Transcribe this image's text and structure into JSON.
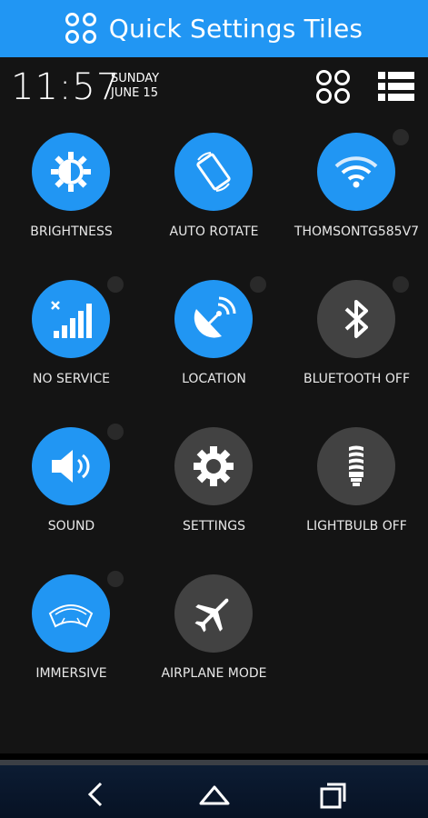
{
  "app": {
    "title": "Quick Settings Tiles",
    "accent": "#2196f3"
  },
  "status": {
    "time": "11:57",
    "day": "SUNDAY",
    "date": "JUNE 15"
  },
  "tiles": [
    {
      "label": "BRIGHTNESS",
      "state": "on",
      "icon": "brightness-icon"
    },
    {
      "label": "AUTO ROTATE",
      "state": "on",
      "icon": "auto-rotate-icon"
    },
    {
      "label": "THOMSONTG585V7",
      "state": "on",
      "icon": "wifi-icon"
    },
    {
      "label": "NO SERVICE",
      "state": "on",
      "icon": "signal-icon"
    },
    {
      "label": "LOCATION",
      "state": "on",
      "icon": "location-icon"
    },
    {
      "label": "BLUETOOTH OFF",
      "state": "off",
      "icon": "bluetooth-icon"
    },
    {
      "label": "SOUND",
      "state": "on",
      "icon": "sound-icon"
    },
    {
      "label": "SETTINGS",
      "state": "off",
      "icon": "gear-icon"
    },
    {
      "label": "LIGHTBULB OFF",
      "state": "off",
      "icon": "lightbulb-icon"
    },
    {
      "label": "IMMERSIVE",
      "state": "on",
      "icon": "immersive-icon"
    },
    {
      "label": "AIRPLANE MODE",
      "state": "off",
      "icon": "airplane-icon"
    }
  ],
  "navbar": {
    "icons": [
      "back-icon",
      "home-icon",
      "recents-icon"
    ]
  }
}
